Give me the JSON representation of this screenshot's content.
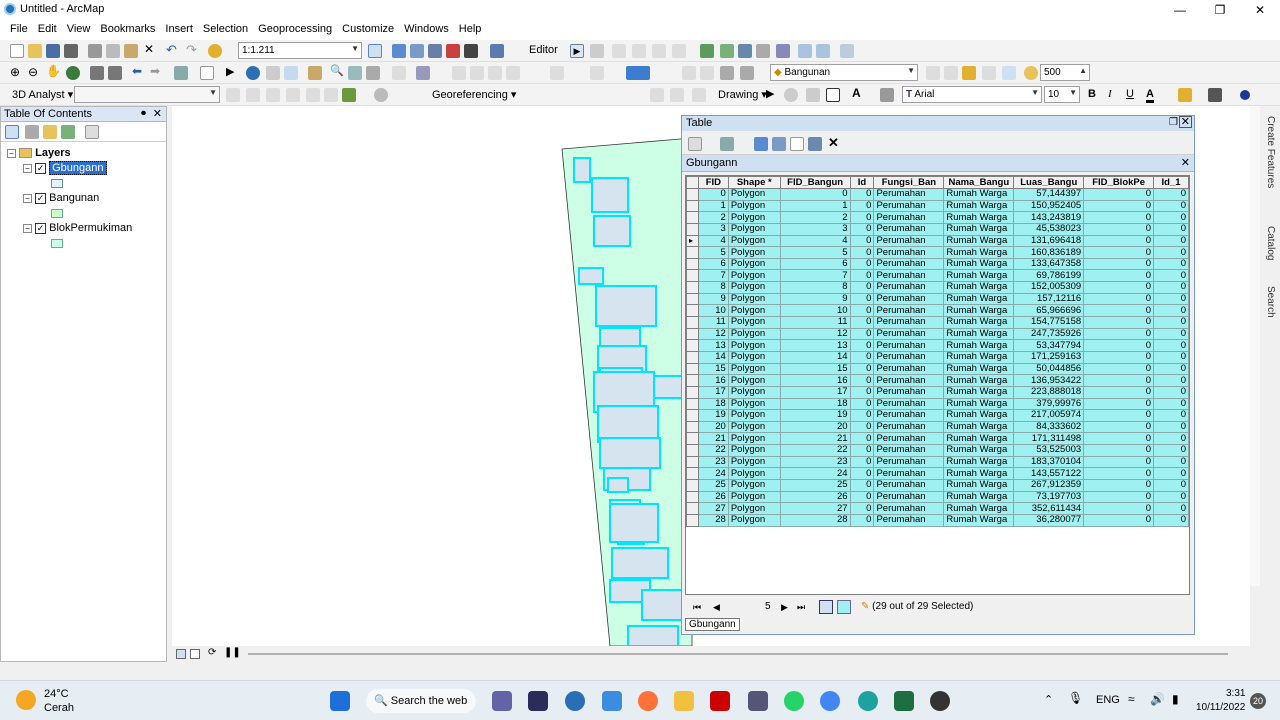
{
  "window": {
    "title": "Untitled - ArcMap"
  },
  "menu": [
    "File",
    "Edit",
    "View",
    "Bookmarks",
    "Insert",
    "Selection",
    "Geoprocessing",
    "Customize",
    "Windows",
    "Help"
  ],
  "toolbar": {
    "scale_value": "1:1.211",
    "editor_label": "Editor",
    "target_layer": "Bangunan",
    "buffer_value": "500",
    "analyst_label": "3D Analyst",
    "georef_label": "Georeferencing",
    "drawing_label": "Drawing",
    "font_name": "Arial",
    "font_size": "10",
    "bold": "B",
    "italic": "I",
    "underline": "U",
    "font_color": "A"
  },
  "toc": {
    "title": "Table Of Contents",
    "root_label": "Layers",
    "layers": [
      {
        "name": "Gbungann",
        "selected": true
      },
      {
        "name": "Bangunan",
        "selected": false
      },
      {
        "name": "BlokPermukiman",
        "selected": false
      }
    ]
  },
  "table": {
    "window_title": "Table",
    "tab_title": "Gbungann",
    "columns": [
      "FID",
      "Shape *",
      "FID_Bangun",
      "Id",
      "Fungsi_Ban",
      "Nama_Bangu",
      "Luas_Bangu",
      "FID_BlokPe",
      "Id_1"
    ],
    "rows": [
      [
        "0",
        "Polygon",
        "0",
        "0",
        "Perumahan",
        "Rumah Warga",
        "57,144397",
        "0",
        "0"
      ],
      [
        "1",
        "Polygon",
        "1",
        "0",
        "Perumahan",
        "Rumah Warga",
        "150,952405",
        "0",
        "0"
      ],
      [
        "2",
        "Polygon",
        "2",
        "0",
        "Perumahan",
        "Rumah Warga",
        "143,243819",
        "0",
        "0"
      ],
      [
        "3",
        "Polygon",
        "3",
        "0",
        "Perumahan",
        "Rumah Warga",
        "45,538023",
        "0",
        "0"
      ],
      [
        "4",
        "Polygon",
        "4",
        "0",
        "Perumahan",
        "Rumah Warga",
        "131,696418",
        "0",
        "0"
      ],
      [
        "5",
        "Polygon",
        "5",
        "0",
        "Perumahan",
        "Rumah Warga",
        "160,836189",
        "0",
        "0"
      ],
      [
        "6",
        "Polygon",
        "6",
        "0",
        "Perumahan",
        "Rumah Warga",
        "133,647358",
        "0",
        "0"
      ],
      [
        "7",
        "Polygon",
        "7",
        "0",
        "Perumahan",
        "Rumah Warga",
        "69,786199",
        "0",
        "0"
      ],
      [
        "8",
        "Polygon",
        "8",
        "0",
        "Perumahan",
        "Rumah Warga",
        "152,005309",
        "0",
        "0"
      ],
      [
        "9",
        "Polygon",
        "9",
        "0",
        "Perumahan",
        "Rumah Warga",
        "157,12116",
        "0",
        "0"
      ],
      [
        "10",
        "Polygon",
        "10",
        "0",
        "Perumahan",
        "Rumah Warga",
        "65,966696",
        "0",
        "0"
      ],
      [
        "11",
        "Polygon",
        "11",
        "0",
        "Perumahan",
        "Rumah Warga",
        "154,775158",
        "0",
        "0"
      ],
      [
        "12",
        "Polygon",
        "12",
        "0",
        "Perumahan",
        "Rumah Warga",
        "247,735926",
        "0",
        "0"
      ],
      [
        "13",
        "Polygon",
        "13",
        "0",
        "Perumahan",
        "Rumah Warga",
        "53,347794",
        "0",
        "0"
      ],
      [
        "14",
        "Polygon",
        "14",
        "0",
        "Perumahan",
        "Rumah Warga",
        "171,259163",
        "0",
        "0"
      ],
      [
        "15",
        "Polygon",
        "15",
        "0",
        "Perumahan",
        "Rumah Warga",
        "50,044856",
        "0",
        "0"
      ],
      [
        "16",
        "Polygon",
        "16",
        "0",
        "Perumahan",
        "Rumah Warga",
        "136,953422",
        "0",
        "0"
      ],
      [
        "17",
        "Polygon",
        "17",
        "0",
        "Perumahan",
        "Rumah Warga",
        "223,888018",
        "0",
        "0"
      ],
      [
        "18",
        "Polygon",
        "18",
        "0",
        "Perumahan",
        "Rumah Warga",
        "379,99976",
        "0",
        "0"
      ],
      [
        "19",
        "Polygon",
        "19",
        "0",
        "Perumahan",
        "Rumah Warga",
        "217,005974",
        "0",
        "0"
      ],
      [
        "20",
        "Polygon",
        "20",
        "0",
        "Perumahan",
        "Rumah Warga",
        "84,333602",
        "0",
        "0"
      ],
      [
        "21",
        "Polygon",
        "21",
        "0",
        "Perumahan",
        "Rumah Warga",
        "171,311498",
        "0",
        "0"
      ],
      [
        "22",
        "Polygon",
        "22",
        "0",
        "Perumahan",
        "Rumah Warga",
        "53,525003",
        "0",
        "0"
      ],
      [
        "23",
        "Polygon",
        "23",
        "0",
        "Perumahan",
        "Rumah Warga",
        "183,370104",
        "0",
        "0"
      ],
      [
        "24",
        "Polygon",
        "24",
        "0",
        "Perumahan",
        "Rumah Warga",
        "143,557122",
        "0",
        "0"
      ],
      [
        "25",
        "Polygon",
        "25",
        "0",
        "Perumahan",
        "Rumah Warga",
        "267,912359",
        "0",
        "0"
      ],
      [
        "26",
        "Polygon",
        "26",
        "0",
        "Perumahan",
        "Rumah Warga",
        "73,197703",
        "0",
        "0"
      ],
      [
        "27",
        "Polygon",
        "27",
        "0",
        "Perumahan",
        "Rumah Warga",
        "352,611434",
        "0",
        "0"
      ],
      [
        "28",
        "Polygon",
        "28",
        "0",
        "Perumahan",
        "Rumah Warga",
        "36,280077",
        "0",
        "0"
      ]
    ],
    "current_record": "5",
    "selection_status": "(29 out of 29 Selected)",
    "bottom_tab": "Gbungann"
  },
  "right_dock": [
    "Create Features",
    "Catalog",
    "Search"
  ],
  "taskbar": {
    "weather_temp": "24°C",
    "weather_desc": "Cerah",
    "search_label": "Search the web",
    "language": "ENG",
    "time": "3:31",
    "date": "10/11/2022",
    "notification_count": "20"
  },
  "colors": {
    "selection_cyan": "#00ffff",
    "block_fill": "#ccffe6",
    "row_fill": "#9ff1f1",
    "building_fill": "#d6e4f0"
  }
}
